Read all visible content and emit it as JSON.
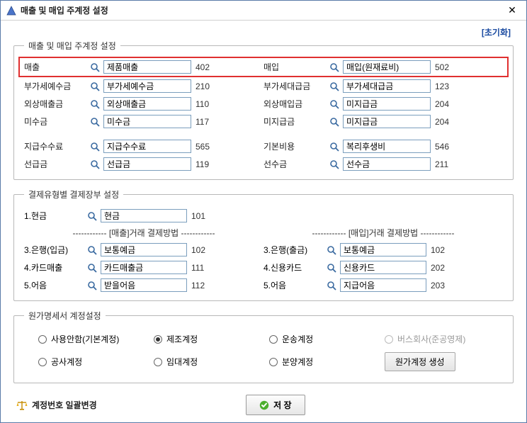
{
  "window": {
    "title": "매출 및 매입 주계정 설정",
    "reset": "[초기화]"
  },
  "group1": {
    "legend": "매출 및 매입 주계정 설정",
    "rows": [
      {
        "l": {
          "label": "매출",
          "val": "제품매출",
          "code": "402"
        },
        "r": {
          "label": "매입",
          "val": "매입(원재료비)",
          "code": "502"
        }
      },
      {
        "l": {
          "label": "부가세예수금",
          "val": "부가세예수금",
          "code": "210"
        },
        "r": {
          "label": "부가세대급금",
          "val": "부가세대급금",
          "code": "123"
        }
      },
      {
        "l": {
          "label": "외상매출금",
          "val": "외상매출금",
          "code": "110"
        },
        "r": {
          "label": "외상매입금",
          "val": "미지급금",
          "code": "204"
        }
      },
      {
        "l": {
          "label": "미수금",
          "val": "미수금",
          "code": "117"
        },
        "r": {
          "label": "미지급금",
          "val": "미지급금",
          "code": "204"
        }
      },
      {
        "l": {
          "label": "지급수수료",
          "val": "지급수수료",
          "code": "565"
        },
        "r": {
          "label": "기본비용",
          "val": "복리후생비",
          "code": "546"
        }
      },
      {
        "l": {
          "label": "선급금",
          "val": "선급금",
          "code": "119"
        },
        "r": {
          "label": "선수금",
          "val": "선수금",
          "code": "211"
        }
      }
    ]
  },
  "group2": {
    "legend": "결제유형별 결제장부 설정",
    "cash": {
      "label": "1.현금",
      "val": "현금",
      "code": "101"
    },
    "header_left": "------------ [매출]거래 결제방법 ------------",
    "header_right": "------------ [매입]거래 결제방법 ------------",
    "left": [
      {
        "label": "3.은행(입금)",
        "val": "보통예금",
        "code": "102"
      },
      {
        "label": "4.카드매출",
        "val": "카드매출금",
        "code": "111"
      },
      {
        "label": "5.어음",
        "val": "받을어음",
        "code": "112"
      }
    ],
    "right": [
      {
        "label": "3.은행(출금)",
        "val": "보통예금",
        "code": "102"
      },
      {
        "label": "4.신용카드",
        "val": "신용카드",
        "code": "202"
      },
      {
        "label": "5.어음",
        "val": "지급어음",
        "code": "203"
      }
    ]
  },
  "group3": {
    "legend": "원가명세서 계정설정",
    "options": {
      "none": "사용안함(기본계정)",
      "manuf": "제조계정",
      "trans": "운송계정",
      "bus": "버스회사(준공영제)",
      "const": "공사계정",
      "lease": "임대계정",
      "sale": "분양계정"
    },
    "button": "원가계정 생성",
    "selected": "manuf"
  },
  "bottom": {
    "batch": "계정번호 일괄변경",
    "save": "저 장"
  }
}
